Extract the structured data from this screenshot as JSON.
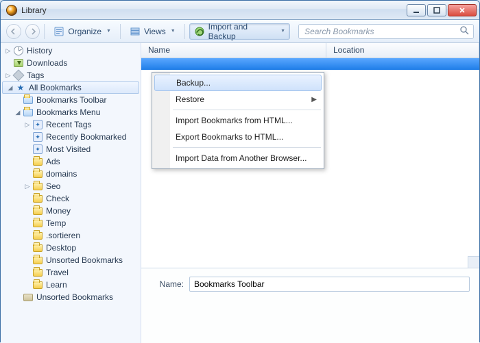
{
  "window": {
    "title": "Library"
  },
  "toolbar": {
    "organize": "Organize",
    "views": "Views",
    "import_backup": "Import and Backup"
  },
  "search": {
    "placeholder": "Search Bookmarks"
  },
  "menu": {
    "backup": "Backup...",
    "restore": "Restore",
    "import_html": "Import Bookmarks from HTML...",
    "export_html": "Export Bookmarks to HTML...",
    "import_browser": "Import Data from Another Browser..."
  },
  "columns": {
    "name": "Name",
    "location": "Location"
  },
  "detail": {
    "name_label": "Name:",
    "name_value": "Bookmarks Toolbar"
  },
  "tree": {
    "history": "History",
    "downloads": "Downloads",
    "tags": "Tags",
    "all_bookmarks": "All Bookmarks",
    "bookmarks_toolbar": "Bookmarks Toolbar",
    "bookmarks_menu": "Bookmarks Menu",
    "recent_tags": "Recent Tags",
    "recently_bookmarked": "Recently Bookmarked",
    "most_visited": "Most Visited",
    "ads": "Ads",
    "domains": "domains",
    "seo": "Seo",
    "check": "Check",
    "money": "Money",
    "temp": "Temp",
    "sortieren": ".sortieren",
    "desktop": "Desktop",
    "unsorted_bookmarks_folder": "Unsorted Bookmarks",
    "travel": "Travel",
    "learn": "Learn",
    "unsorted_bookmarks": "Unsorted Bookmarks"
  }
}
